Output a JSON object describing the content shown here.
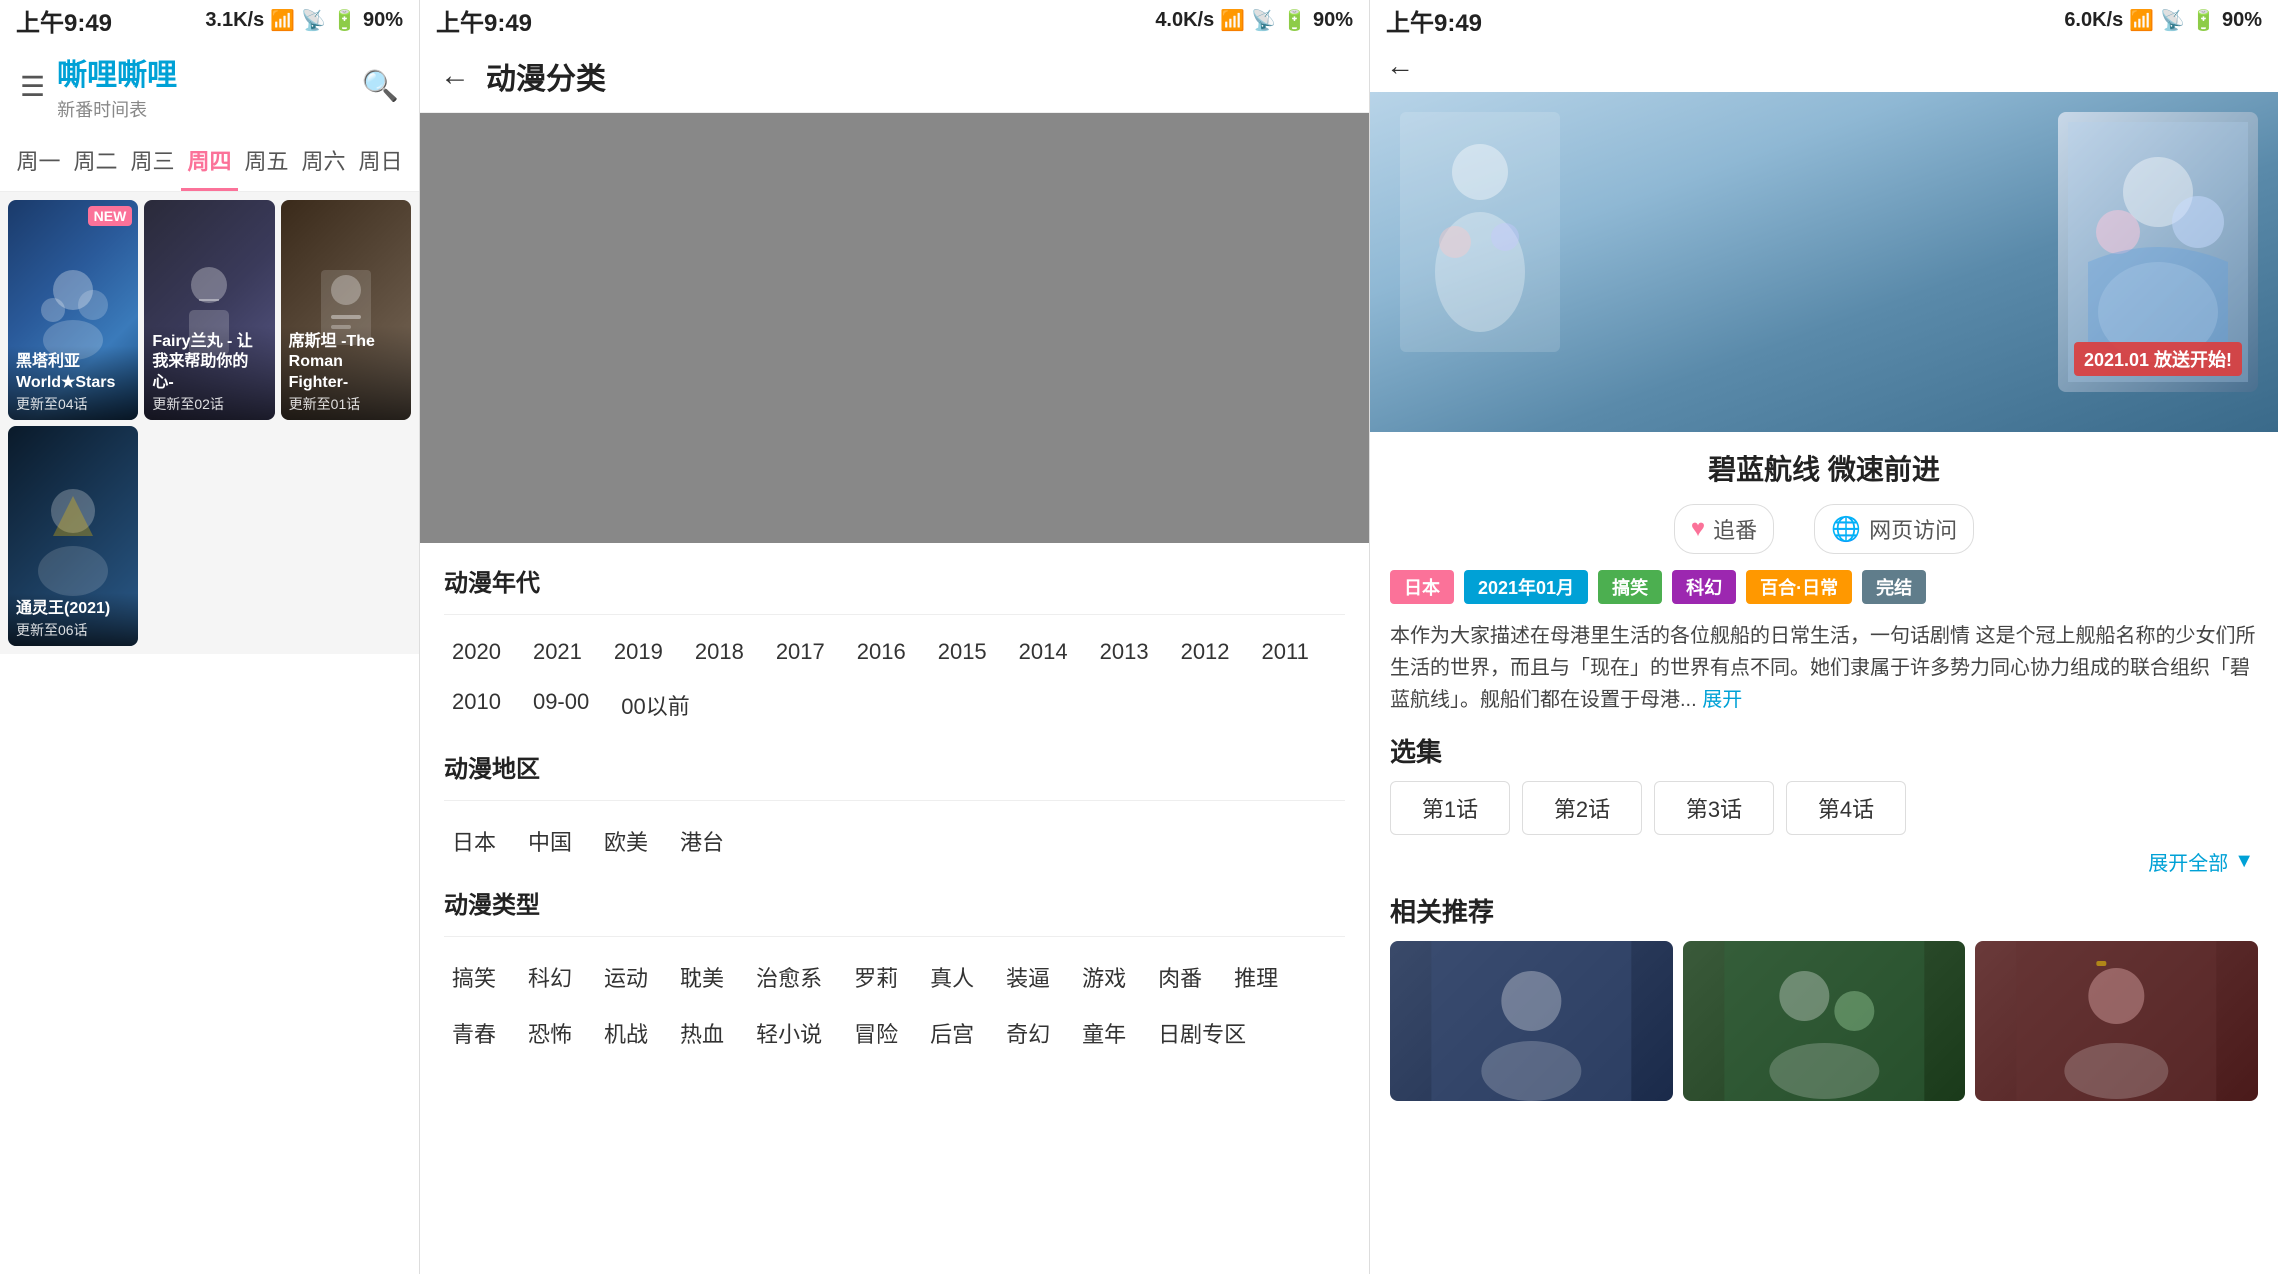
{
  "panel1": {
    "time": "上午9:49",
    "network": "3.1K/s",
    "battery": "90%",
    "logo": "嘶哩嘶哩",
    "subtitle": "新番时间表",
    "weekdays": [
      "周一",
      "周二",
      "周三",
      "周四",
      "周五",
      "周六",
      "周日"
    ],
    "active_day_index": 3,
    "anime_cards": [
      {
        "title": "黑塔利亚 World★Stars",
        "episode": "更新至04话",
        "bg": "card-bg-1",
        "badge": "NEW",
        "badge_color": "#fb7299"
      },
      {
        "title": "Fairy兰丸 - 让我来帮助你的心-",
        "episode": "更新至02话",
        "bg": "card-bg-2",
        "badge": null,
        "badge_color": null
      },
      {
        "title": "席斯坦 -The Roman Fighter-",
        "episode": "更新至01话",
        "bg": "card-bg-3",
        "badge": null,
        "badge_color": null
      },
      {
        "title": "通灵王(2021)",
        "episode": "更新至06话",
        "bg": "card-bg-4",
        "badge": null,
        "badge_color": null
      }
    ],
    "search_label": "搜索",
    "hamburger_label": "菜单"
  },
  "panel2": {
    "time": "上午9:49",
    "network": "4.0K/s",
    "battery": "90%",
    "back_label": "返回",
    "title": "动漫分类",
    "sections": [
      {
        "section_title": "动漫年代",
        "tags": [
          "2020",
          "2021",
          "2019",
          "2018",
          "2017",
          "2016",
          "2015",
          "2014",
          "2013",
          "2012",
          "2011",
          "2010",
          "09-00",
          "00以前"
        ]
      },
      {
        "section_title": "动漫地区",
        "tags": [
          "日本",
          "中国",
          "欧美",
          "港台"
        ]
      },
      {
        "section_title": "动漫类型",
        "tags": [
          "搞笑",
          "科幻",
          "运动",
          "耽美",
          "治愈系",
          "罗莉",
          "真人",
          "装逼",
          "游戏",
          "肉番",
          "推理",
          "青春",
          "恐怖",
          "机战",
          "热血",
          "轻小说",
          "冒险",
          "后宫",
          "奇幻",
          "童年",
          "日剧专区"
        ]
      }
    ]
  },
  "panel3": {
    "time": "上午9:49",
    "network": "6.0K/s",
    "battery": "90%",
    "back_label": "返回",
    "anime_title": "碧蓝航线 微速前进",
    "hero_badge": "2021.01 放送开始!",
    "action_follow": "追番",
    "action_web": "网页访问",
    "tags": [
      "日本",
      "2021年01月",
      "搞笑",
      "科幻",
      "百合·日常",
      "完结"
    ],
    "description": "本作为大家描述在母港里生活的各位舰船的日常生活，一句话剧情 这是个冠上舰船名称的少女们所生活的世界，而且与「现在」的世界有点不同。她们隶属于许多势力同心协力组成的联合组织「碧蓝航线」。舰船们都在设置于母港...",
    "expand_label": "展开",
    "episodes_label": "选集",
    "episodes": [
      "第1话",
      "第2话",
      "第3话",
      "第4话"
    ],
    "expand_all_label": "展开全部",
    "related_label": "相关推荐"
  }
}
